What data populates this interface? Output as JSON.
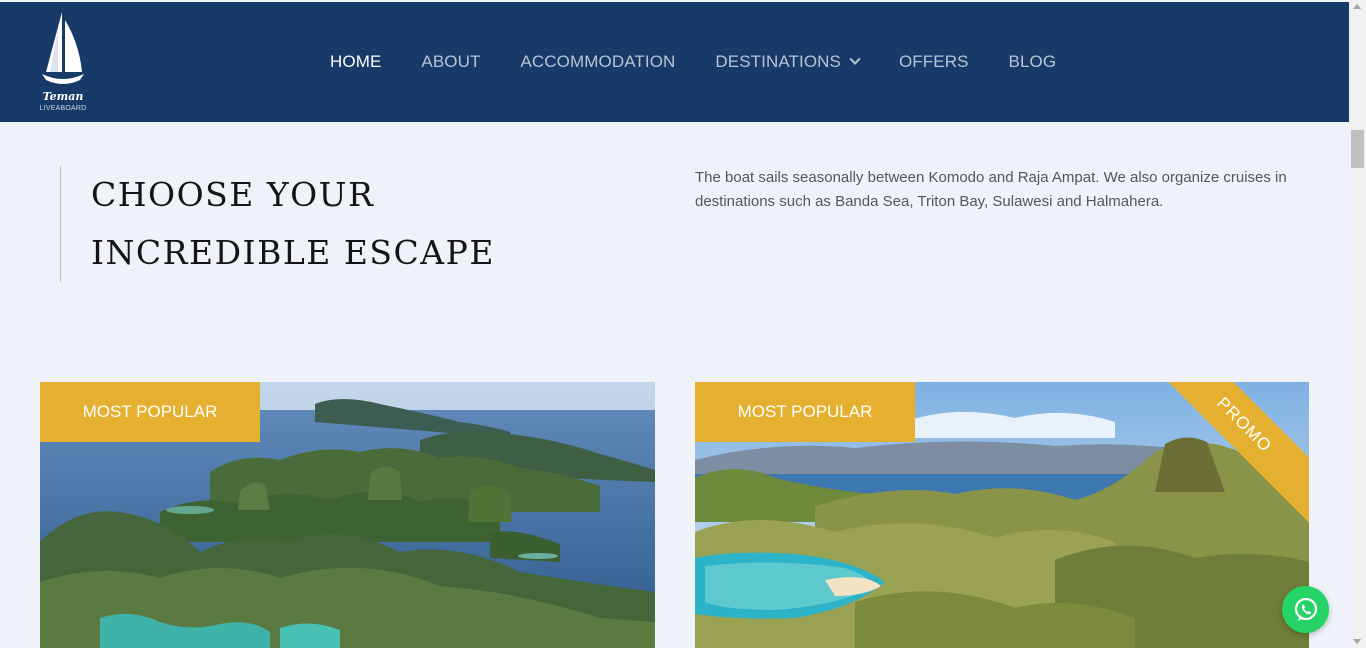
{
  "brand": {
    "name": "Teman",
    "subtitle": "LIVEABOARD"
  },
  "nav": {
    "items": [
      {
        "label": "HOME",
        "active": true
      },
      {
        "label": "ABOUT",
        "active": false
      },
      {
        "label": "ACCOMMODATION",
        "active": false
      },
      {
        "label": "DESTINATIONS",
        "active": false,
        "has_dropdown": true
      },
      {
        "label": "OFFERS",
        "active": false
      },
      {
        "label": "BLOG",
        "active": false
      }
    ]
  },
  "intro": {
    "heading_line1": "CHOOSE YOUR",
    "heading_line2": "INCREDIBLE ESCAPE",
    "description": "The boat sails seasonally between Komodo and Raja Ampat. We also organize cruises in destinations such as Banda Sea, Triton Bay, Sulawesi and Halmahera."
  },
  "cards": [
    {
      "badge": "MOST POPULAR",
      "image": "raja-ampat-islands"
    },
    {
      "badge": "MOST POPULAR",
      "ribbon": "PROMO",
      "image": "padar-island-hills"
    }
  ],
  "colors": {
    "header": "#183a68",
    "accent": "#e5b030",
    "page_bg": "#eff3f9",
    "whatsapp": "#25d366"
  },
  "icons": {
    "whatsapp": "whatsapp-icon",
    "dropdown": "chevron-down-icon",
    "logo": "sailboat-logo-icon"
  }
}
